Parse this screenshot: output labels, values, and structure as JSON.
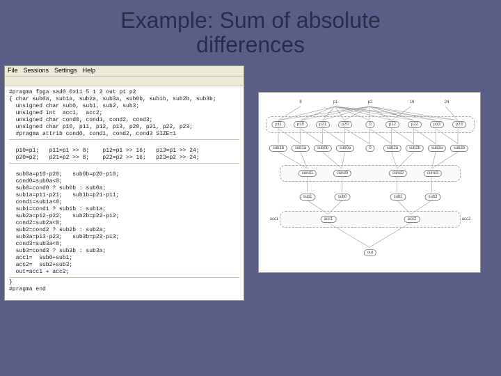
{
  "slide": {
    "title_line1": "Example: Sum of absolute",
    "title_line2": "differences"
  },
  "editor": {
    "menu": {
      "file": "File",
      "sessions": "Sessions",
      "settings": "Settings",
      "help": "Help"
    },
    "code": [
      "#pragma fpga sad0 0x11 5 1 2 out p1 p2",
      "{ char sub0a, sub1a, sub2a, sub3a, sub0b, sub1b, sub2b, sub3b;",
      "  unsigned char sub0, sub1, sub2, sub3;",
      "  unsigned int  acc1,  acc2;",
      "  unsigned char cond0, cond1, cond2, cond3;",
      "  unsigned char p10, p11, p12, p13, p20, p21, p22, p23;",
      "  #pragma attrib cond0, cond1, cond2, cond3 SIZE=1",
      "",
      "  p10=p1;   p11=p1 >> 8;    p12=p1 >> 16;   p13=p1 >> 24;",
      "  p20=p2;   p21=p2 >> 8;    p22=p2 >> 16;   p23=p2 >> 24;",
      "",
      "  sub0a=p10-p20;   sub0b=p20-p10;",
      "  cond0=sub0a<0;",
      "  sub0=cond0 ? sub0b : sub0a;",
      "  sub1a=p11-p21;   sub1b=p21-p11;",
      "  cond1=sub1a<0;",
      "  sub1=cond1 ? sub1b : sub1a;",
      "  sub2a=p12-p22;   sub2b=p22-p12;",
      "  cond2=sub2a<0;",
      "  sub2=cond2 ? sub2b : sub2a;",
      "  sub3a=p13-p23;   sub3b=p23-p13;",
      "  cond3=sub3a<0;",
      "  sub3=cond3 ? sub3b : sub3a;",
      "  acc1=  sub0+sub1;",
      "  acc2=  sub2+sub3;",
      "  out=acc1 + acc2;",
      "}",
      "#pragma end"
    ]
  },
  "diagram": {
    "top_inputs": [
      "8",
      "p1",
      "p2",
      "16",
      "24"
    ],
    "row_p": [
      "p11",
      "p10",
      "p21",
      "p20",
      "0",
      "p12",
      "p22",
      "p13",
      "p23"
    ],
    "row_sub_ab": [
      "sub1b",
      "sub1a",
      "sub0b",
      "sub0a",
      "0",
      "sub2a",
      "sub2b",
      "sub3a",
      "sub3b"
    ],
    "row_cond": [
      "cond1",
      "cond0",
      "cond2",
      "cond3"
    ],
    "row_sub": [
      "sub1",
      "sub0",
      "sub2",
      "sub3"
    ],
    "row_acc": [
      "acc1",
      "acc2"
    ],
    "acc_side": [
      "acc1",
      "acc2"
    ],
    "out": "out"
  }
}
